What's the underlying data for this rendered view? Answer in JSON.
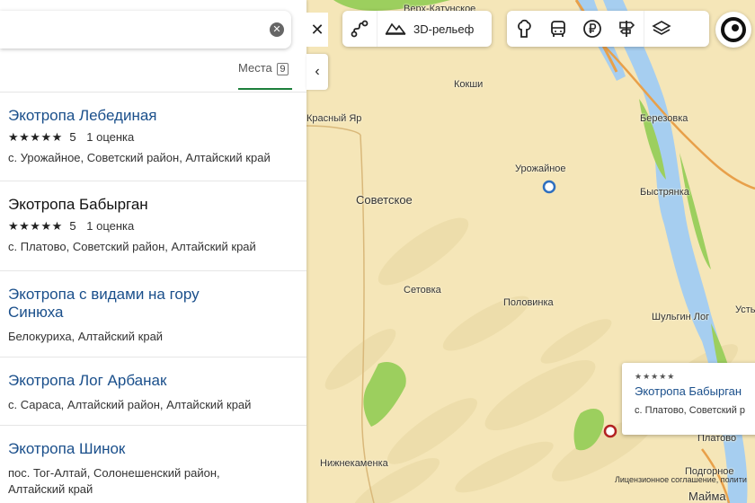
{
  "search": {
    "value": "",
    "clear_icon": "clear-icon"
  },
  "tabs": {
    "places_label": "Места",
    "places_count": "9"
  },
  "results": [
    {
      "title": "Экотропа Лебединая",
      "stars": "★★★★★",
      "rating": "5",
      "reviews": "1 оценка",
      "address": "с. Урожайное, Советский район, Алтайский край"
    },
    {
      "title": "Экотропа Бабырган",
      "stars": "★★★★★",
      "rating": "5",
      "reviews": "1 оценка",
      "address": "с. Платово, Советский район, Алтайский край"
    },
    {
      "title_line1": "Экотропа с видами на гору",
      "title_line2": "Синюха",
      "address": "Белокуриха, Алтайский край"
    },
    {
      "title": "Экотропа Лог Арбанак",
      "address": "с. Сараса, Алтайский район, Алтайский край"
    },
    {
      "title": "Экотропа Шинок",
      "address_line1": "пос. Тог-Алтай, Солонешенский район,",
      "address_line2": "Алтайский край"
    }
  ],
  "toolbar": {
    "relief_label": "3D-рельеф",
    "icons": [
      "route-icon",
      "relief-icon",
      "attraction-icon",
      "transport-icon",
      "ruble-icon",
      "signpost-icon",
      "layers-icon"
    ]
  },
  "map": {
    "labels": {
      "verkh_katunskoe": "Верх-Катунское",
      "kokshi": "Кокши",
      "krasny_yar": "Красный Яр",
      "berezovka": "Березовка",
      "urozhainoe": "Урожайное",
      "sovetskoe": "Советское",
      "bystryanka": "Быстрянка",
      "setovka": "Сетовка",
      "polovinka": "Половинка",
      "shulgin_log": "Шульгин Лог",
      "ust": "Усть",
      "platovo": "Платово",
      "nizhnekamenka": "Нижнекаменка",
      "podgornoe": "Подгорное",
      "maima": "Майма"
    }
  },
  "popup": {
    "stars": "★★★★★",
    "title": "Экотропа Бабырган",
    "address": "с. Платово, Советский р"
  },
  "copyright": "Лицензионное соглашение, полити",
  "colors": {
    "link": "#1a4f8b",
    "accent": "#1d7f3b",
    "land": "#f5e6b8",
    "water": "#a6cef0",
    "forest": "#9ccf5e",
    "road": "#e8a04a"
  }
}
